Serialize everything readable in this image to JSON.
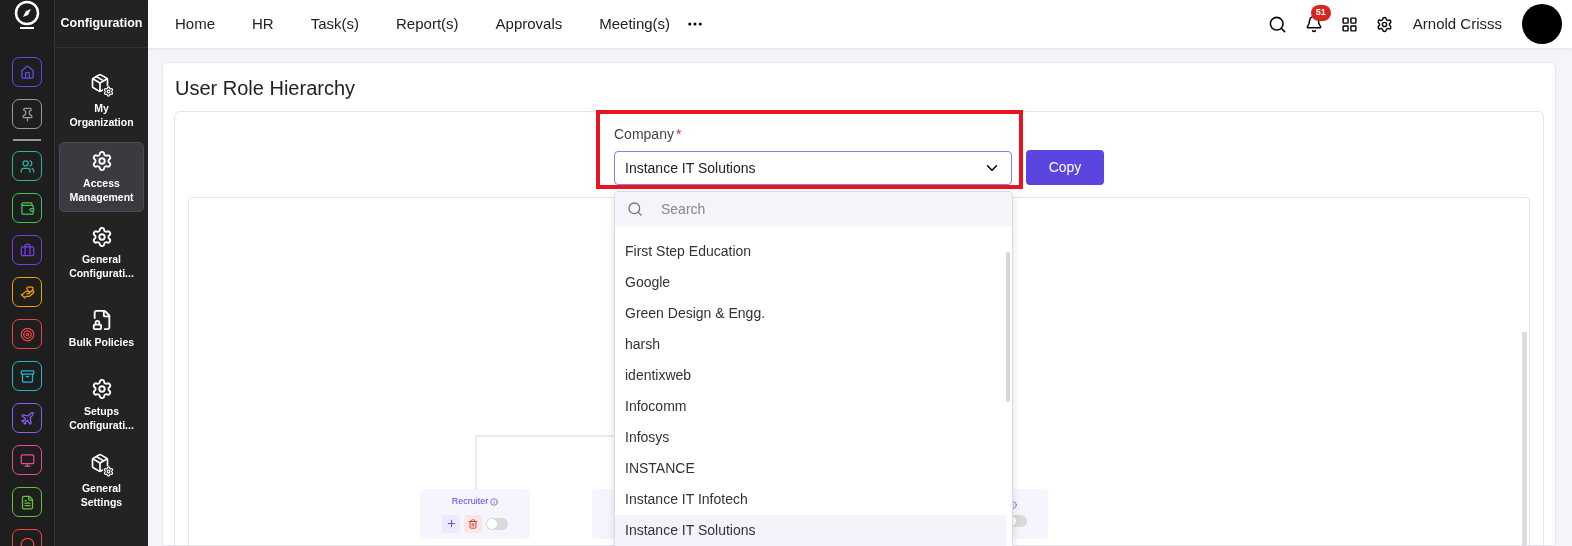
{
  "app_rail": {
    "items": [
      {
        "kind": "home",
        "color": "#5b4ee6",
        "selected": false
      },
      {
        "kind": "pin",
        "color": "#9a9a9a",
        "selected": false
      },
      {
        "kind": "people",
        "color": "#2bb3a3",
        "selected": false
      },
      {
        "kind": "wallet",
        "color": "#3ec45a",
        "selected": false
      },
      {
        "kind": "briefcase",
        "color": "#7c3aed",
        "selected": false
      },
      {
        "kind": "hands",
        "color": "#f59e0b",
        "selected": false
      },
      {
        "kind": "target",
        "color": "#ef4444",
        "selected": false
      },
      {
        "kind": "archive",
        "color": "#22b5d6",
        "selected": false
      },
      {
        "kind": "plane",
        "color": "#8b5cf6",
        "selected": false
      },
      {
        "kind": "monitor",
        "color": "#ec4899",
        "selected": false
      },
      {
        "kind": "file",
        "color": "#65c23a",
        "selected": false
      },
      {
        "kind": "partial",
        "color": "#ef4444",
        "selected": false
      }
    ]
  },
  "section_menu": {
    "title": "Configuration",
    "items": [
      {
        "label": "My Organization",
        "kind": "box-gear",
        "selected": false
      },
      {
        "label": "Access Management",
        "kind": "gear",
        "selected": true
      },
      {
        "label": "General Configurati...",
        "kind": "gear",
        "selected": false
      },
      {
        "label": "Bulk Policies",
        "kind": "file-shield",
        "selected": false
      },
      {
        "label": "Setups Configurati...",
        "kind": "gear",
        "selected": false
      },
      {
        "label": "General Settings",
        "kind": "box-gear",
        "selected": false
      }
    ]
  },
  "top_nav": {
    "items": [
      {
        "label": "Home"
      },
      {
        "label": "HR"
      },
      {
        "label": "Task(s)"
      },
      {
        "label": "Report(s)"
      },
      {
        "label": "Approvals"
      },
      {
        "label": "Meeting(s)"
      }
    ],
    "notification_count": "51",
    "user_name": "Arnold Crisss"
  },
  "page": {
    "title": "User Role Hierarchy",
    "company_field": {
      "label": "Company",
      "required_mark": "*",
      "value": "Instance IT Solutions"
    },
    "copy_button": "Copy",
    "dropdown": {
      "placeholder": "Search",
      "options": [
        {
          "label": "First Step Education",
          "selected": false
        },
        {
          "label": "Google",
          "selected": false
        },
        {
          "label": "Green Design & Engg.",
          "selected": false
        },
        {
          "label": "harsh",
          "selected": false
        },
        {
          "label": "identixweb",
          "selected": false
        },
        {
          "label": "Infocomm",
          "selected": false
        },
        {
          "label": "Infosys",
          "selected": false
        },
        {
          "label": "INSTANCE",
          "selected": false
        },
        {
          "label": "Instance IT Infotech",
          "selected": false
        },
        {
          "label": "Instance IT Solutions",
          "selected": true
        }
      ]
    },
    "hierarchy_nodes": [
      {
        "kind": "role",
        "label": "Recruiter",
        "on": false
      },
      {
        "kind": "role"
      },
      {
        "kind": "role",
        "on": false
      }
    ]
  }
}
